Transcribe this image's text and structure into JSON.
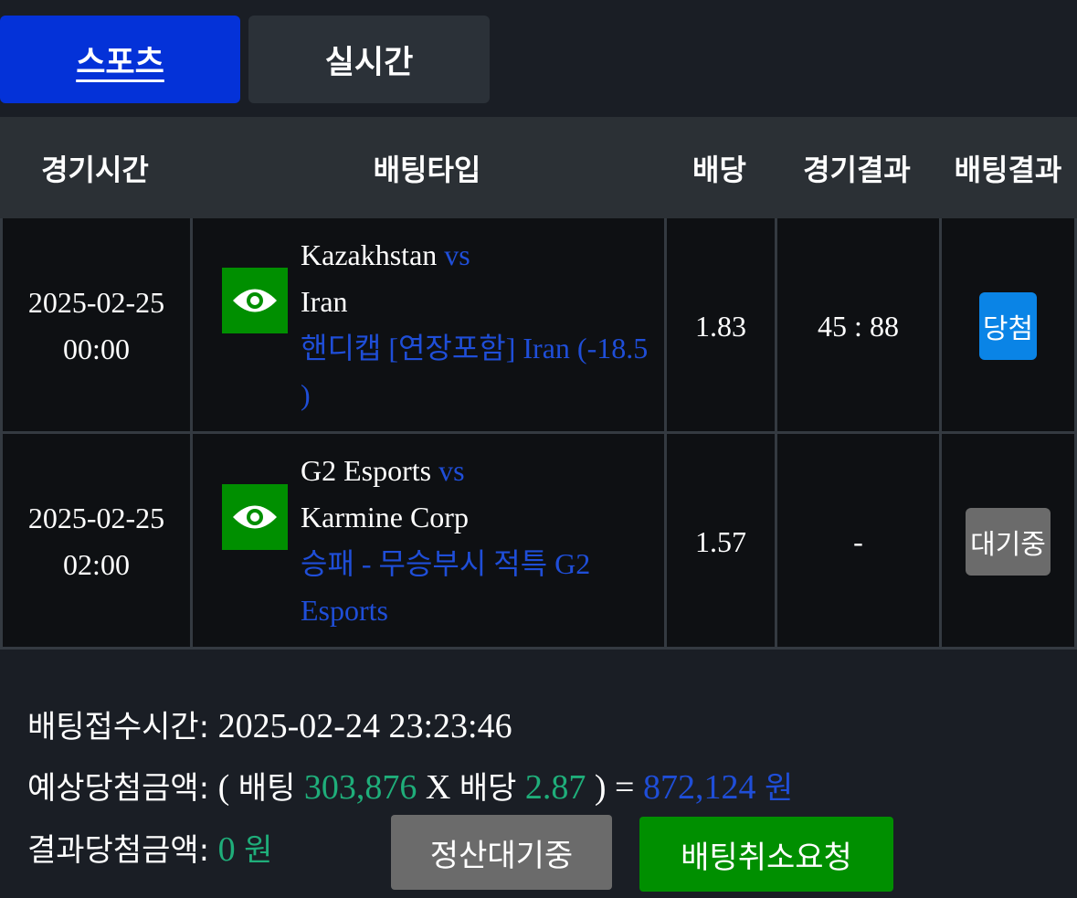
{
  "tabs": {
    "sports": "스포츠",
    "live": "실시간"
  },
  "headers": {
    "time": "경기시간",
    "bet_type": "배팅타입",
    "odds": "배당",
    "game_result": "경기결과",
    "bet_result": "배팅결과"
  },
  "rows": [
    {
      "date": "2025-02-25",
      "time": "00:00",
      "home": "Kazakhstan",
      "vs": "vs",
      "away": "Iran",
      "choice": "핸디캡 [연장포함] Iran (-18.5 )",
      "odds": "1.83",
      "score": "45 : 88",
      "result": "당첨",
      "result_color": "#0a84e6"
    },
    {
      "date": "2025-02-25",
      "time": "02:00",
      "home": "G2 Esports",
      "vs": "vs",
      "away": "Karmine Corp",
      "choice": "승패 - 무승부시 적특 G2 Esports",
      "odds": "1.57",
      "score": "-",
      "result": "대기중",
      "result_color": "#6b6b6b"
    }
  ],
  "summary": {
    "accept_label": "배팅접수시간:",
    "accept_time": "2025-02-24 23:23:46",
    "expected_label": "예상당첨금액:",
    "open_paren": "(",
    "bet_label": "배팅",
    "bet_amount": "303,876",
    "times": "X",
    "odds_label": "배당",
    "total_odds": "2.87",
    "close_eq": ") =",
    "expected_amount": "872,124",
    "won_unit": "원",
    "result_label": "결과당첨금액:",
    "result_amount": "0",
    "result_unit": "원"
  },
  "buttons": {
    "settle": "정산대기중",
    "cancel": "배팅취소요청"
  },
  "icons": {
    "view": "eye-icon"
  },
  "colors": {
    "accent": "#0432d8",
    "green": "#008f00",
    "link_blue": "#1f4ed8",
    "amount_green": "#1fae7a"
  }
}
